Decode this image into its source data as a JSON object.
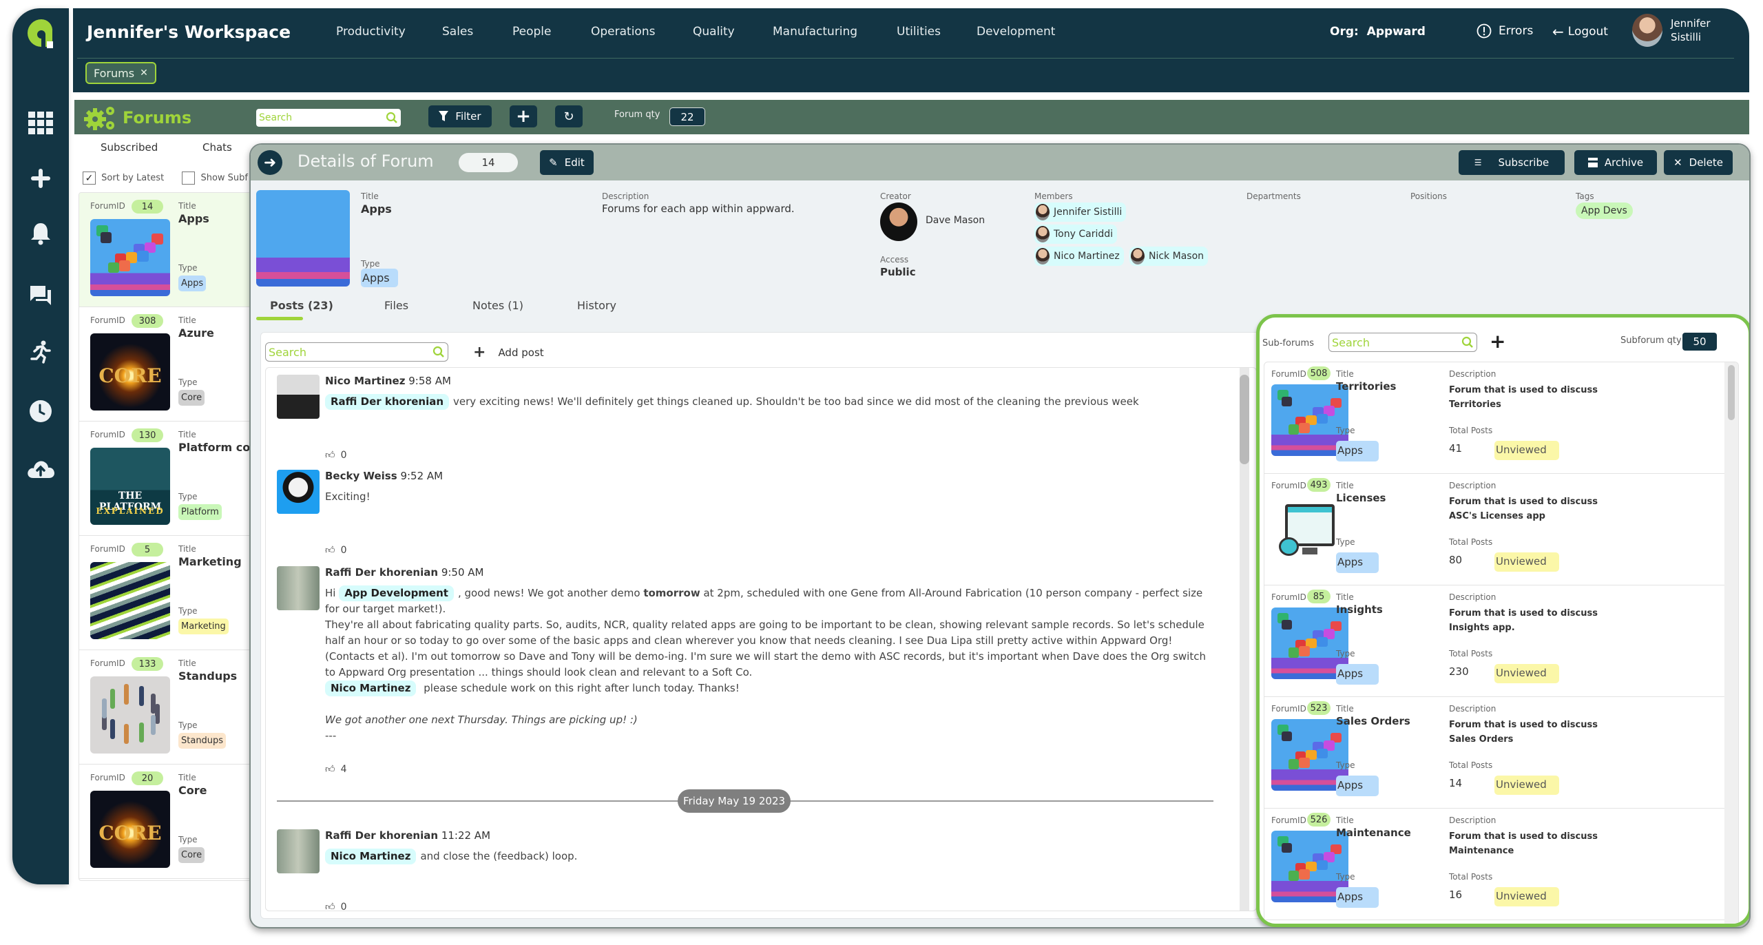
{
  "app": {
    "workspace_title": "Jennifer's Workspace",
    "nav": [
      "Productivity",
      "Sales",
      "People",
      "Operations",
      "Quality",
      "Manufacturing",
      "Utilities",
      "Development"
    ],
    "org_label": "Org:",
    "org_value": "Appward",
    "errors_label": "Errors",
    "logout_label": "Logout",
    "user_first": "Jennifer",
    "user_last": "Sistilli",
    "open_tab": "Forums",
    "rail_icons": [
      "apps-grid-icon",
      "plus-icon",
      "bell-icon",
      "chat-icon",
      "running-icon",
      "clock-icon",
      "cloud-upload-icon"
    ]
  },
  "forums_bar": {
    "title": "Forums",
    "search_placeholder": "Search",
    "filter_label": "Filter",
    "qty_label": "Forum qty",
    "qty_value": "22"
  },
  "forum_list": {
    "tabs": [
      "Subscribed",
      "Chats"
    ],
    "sort_latest_label": "Sort by Latest",
    "sort_latest_checked": true,
    "show_sub_label": "Show Subf",
    "show_sub_checked": false,
    "id_label": "ForumID",
    "title_label": "Title",
    "type_label": "Type",
    "items": [
      {
        "id": "14",
        "title": "Apps",
        "type": "Apps",
        "type_color": "#b9dcfb",
        "thumb": "apps",
        "selected": true
      },
      {
        "id": "308",
        "title": "Azure",
        "type": "Core",
        "type_color": "#d0d0d0",
        "thumb": "core"
      },
      {
        "id": "130",
        "title": "Platform conc",
        "type": "Platform",
        "type_color": "#c9f7b8",
        "thumb": "platform"
      },
      {
        "id": "5",
        "title": "Marketing",
        "type": "Marketing",
        "type_color": "#fbf7a8",
        "thumb": "marketing"
      },
      {
        "id": "133",
        "title": "Standups",
        "type": "Standups",
        "type_color": "#fce6cc",
        "thumb": "standups"
      },
      {
        "id": "20",
        "title": "Core",
        "type": "Core",
        "type_color": "#d0d0d0",
        "thumb": "core"
      }
    ]
  },
  "details": {
    "header_title": "Details of Forum",
    "forum_id": "14",
    "edit_label": "Edit",
    "subscribe_label": "Subscribe",
    "archive_label": "Archive",
    "delete_label": "Delete",
    "title_label": "Title",
    "title": "Apps",
    "type_label": "Type",
    "type": "Apps",
    "description_label": "Description",
    "description": "Forums for each app within appward.",
    "creator_label": "Creator",
    "creator": "Dave Mason",
    "access_label": "Access",
    "access": "Public",
    "members_label": "Members",
    "members": [
      "Jennifer Sistilli",
      "Tony Cariddi",
      "Nico Martinez",
      "Nick Mason"
    ],
    "departments_label": "Departments",
    "positions_label": "Positions",
    "tags_label": "Tags",
    "tags": [
      "App Devs"
    ],
    "tabs": [
      "Posts (23)",
      "Files",
      "Notes (1)",
      "History"
    ],
    "active_tab": "Posts (23)"
  },
  "posts": {
    "search_placeholder": "Search",
    "add_post_label": "Add post",
    "items": [
      {
        "author": "Nico Martinez",
        "time": "9:58 AM",
        "mention": "Raffi Der khorenian",
        "text": "very exciting news! We'll definitely get things cleaned up. Shouldn't be too bad since we did most of the cleaning the previous week",
        "likes": "0"
      },
      {
        "author": "Becky Weiss",
        "time": "9:52 AM",
        "text": "Exciting!",
        "likes": "0"
      },
      {
        "author": "Raffi Der khorenian",
        "time": "9:50 AM",
        "greeting": "Hi",
        "mention": "App Development",
        "text_a": ", good news! We got another demo",
        "bold": "tomorrow",
        "text_b": "at 2pm, scheduled with one Gene from All-Around Fabrication (10 person company - perfect size for our target market!).",
        "para2": "They're all about fabricating quality parts. So, audits, NCR, quality related apps are going to be important to be clean, showing relevant sample records. So let's schedule half an hour or so today to go over some of the basic apps and clean wherever you know that needs cleaning. I see Dua Lipa still pretty active within Appward Org! (Contacts et al). I'm out tomorrow so Dave and Tony will be demo-ing. I'm sure we will start the demo with ASC records, but it's important when Dave does the Org switch to Appward Org presentation ... things should look clean and relevant to a Soft Co.",
        "mention2": "Nico Martinez",
        "para3": "please schedule work on this right after lunch today. Thanks!",
        "italic": "We got another one next Thursday. Things are picking up! :)",
        "rule": "---",
        "likes": "4"
      },
      {
        "author": "Raffi Der khorenian",
        "time": "11:22 AM",
        "mention": "Nico Martinez",
        "text": "and close the (feedback) loop.",
        "likes": "0"
      }
    ],
    "date_separator": "Friday May 19 2023"
  },
  "subforums": {
    "label": "Sub-forums",
    "search_placeholder": "Search",
    "qty_label": "Subforum qty",
    "qty_value": "50",
    "id_label": "ForumID",
    "title_label": "Title",
    "type_label": "Type",
    "desc_label": "Description",
    "posts_label": "Total Posts",
    "items": [
      {
        "id": "508",
        "title": "Territories",
        "type": "Apps",
        "desc": "Forum that is used to discuss Territories",
        "total_posts": "41",
        "status": "Unviewed",
        "thumb": "apps"
      },
      {
        "id": "493",
        "title": "Licenses",
        "type": "Apps",
        "desc": "Forum that is used to discuss ASC's Licenses app",
        "total_posts": "80",
        "status": "Unviewed",
        "thumb": "licenses"
      },
      {
        "id": "85",
        "title": "Insights",
        "type": "Apps",
        "desc": "Forum that is used to discuss Insights app.",
        "total_posts": "230",
        "status": "Unviewed",
        "thumb": "apps"
      },
      {
        "id": "523",
        "title": "Sales Orders",
        "type": "Apps",
        "desc": "Forum that is used to discuss Sales Orders",
        "total_posts": "14",
        "status": "Unviewed",
        "thumb": "apps"
      },
      {
        "id": "526",
        "title": "Maintenance",
        "type": "Apps",
        "desc": "Forum that is used to discuss Maintenance",
        "total_posts": "16",
        "status": "Unviewed",
        "thumb": "apps"
      }
    ]
  },
  "colors": {
    "navy": "#133544",
    "accent_green": "#9fd43a",
    "toolbar_green": "#4e6e5d",
    "mention_bg": "#d7fcfc",
    "unviewed_bg": "#fbf7a8",
    "type_apps_bg": "#b9dcfb"
  }
}
